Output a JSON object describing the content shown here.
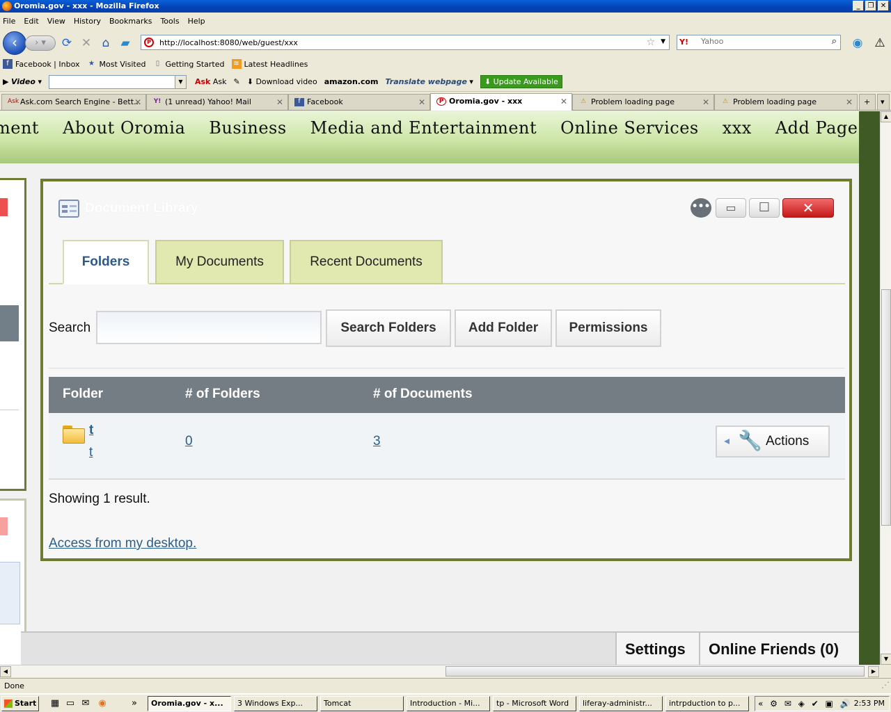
{
  "window": {
    "title": "Oromia.gov - xxx - Mozilla Firefox",
    "controls": [
      "_",
      "❐",
      "✕"
    ]
  },
  "menu": [
    "File",
    "Edit",
    "View",
    "History",
    "Bookmarks",
    "Tools",
    "Help"
  ],
  "navbar": {
    "url": "http://localhost:8080/web/guest/xxx",
    "search_placeholder": "Yahoo",
    "search_engine": "Y!"
  },
  "bookmarks": [
    "Facebook | Inbox",
    "Most Visited",
    "Getting Started",
    "Latest Headlines"
  ],
  "asktoolbar": {
    "video_label": "Video",
    "ask_label": "Ask",
    "download_label": "Download video",
    "amazon_label": "amazon.com",
    "translate_label": "Translate webpage",
    "update_label": "Update Available"
  },
  "tabs": [
    {
      "label": "Ask.com Search Engine - Bett...",
      "icon": "Ask"
    },
    {
      "label": "(1 unread) Yahoo! Mail",
      "icon": "Y!"
    },
    {
      "label": "Facebook",
      "icon": "f"
    },
    {
      "label": "Oromia.gov - xxx",
      "icon": "P"
    },
    {
      "label": "Problem loading page",
      "icon": "⚠"
    },
    {
      "label": "Problem loading page",
      "icon": "⚠"
    }
  ],
  "sitenav": [
    "ment",
    "About Oromia",
    "Business",
    "Media and Entertainment",
    "Online Services",
    "xxx",
    "Add Page"
  ],
  "portlet": {
    "title": "Document Library",
    "tabs": [
      "Folders",
      "My Documents",
      "Recent Documents"
    ],
    "search_label": "Search",
    "search_value": "",
    "buttons": [
      "Search Folders",
      "Add Folder",
      "Permissions"
    ],
    "columns": [
      "Folder",
      "# of Folders",
      "# of Documents"
    ],
    "rows": [
      {
        "name": "t",
        "description": "t",
        "folders": "0",
        "documents": "3",
        "actions": "Actions"
      }
    ],
    "showing": "Showing 1 result.",
    "access_link": "Access from my desktop."
  },
  "dock": {
    "settings": "Settings",
    "friends": "Online Friends (0)"
  },
  "status": "Done",
  "taskbar": {
    "start": "Start",
    "tasks": [
      "Oromia.gov - x...",
      "3 Windows Exp...",
      "Tomcat",
      "Introduction - Mi...",
      "tp - Microsoft Word",
      "liferay-administr...",
      "intrpduction to p..."
    ],
    "clock": "2:53 PM"
  }
}
